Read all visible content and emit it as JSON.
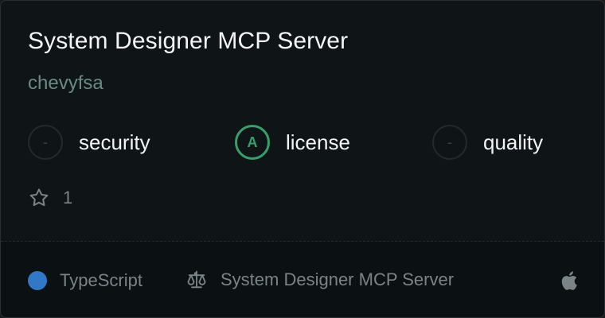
{
  "card": {
    "title": "System Designer MCP Server",
    "author": "chevyfsa",
    "scores": [
      {
        "grade": "-",
        "label": "security"
      },
      {
        "grade": "A",
        "label": "license"
      },
      {
        "grade": "-",
        "label": "quality"
      }
    ],
    "stars": "1",
    "footer": {
      "language": "TypeScript",
      "language_color": "#3178c6",
      "license": "System Designer MCP Server",
      "platform_icon": "apple-icon"
    }
  }
}
